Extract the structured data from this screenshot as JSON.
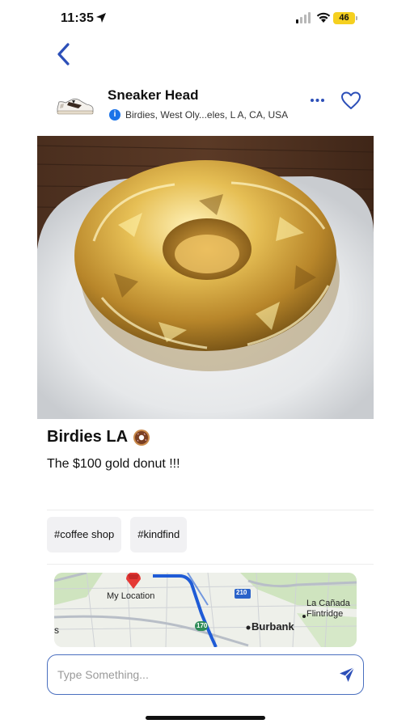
{
  "status_bar": {
    "time": "11:35",
    "battery": "46"
  },
  "post": {
    "user_name": "Sneaker Head",
    "location": "Birdies, West Oly...eles, L A, CA, USA",
    "title": "Birdies LA",
    "title_emoji": "🍩",
    "caption": "The $100 gold donut !!!",
    "tags": [
      "#coffee shop",
      "#kindfind"
    ]
  },
  "map": {
    "labels": {
      "my_location": "My Location",
      "la_canada": "La Cañada",
      "flintridge": "Flintridge",
      "burbank": "Burbank",
      "hwy_210": "210",
      "hwy_170": "170",
      "edge_fragment": "s"
    }
  },
  "input": {
    "placeholder": "Type Something..."
  },
  "icons": {
    "back": "chevron-left-icon",
    "more": "more-dots-icon",
    "favorite": "heart-outline-icon",
    "send": "send-icon",
    "info": "info-icon"
  },
  "colors": {
    "accent": "#2c4fb8",
    "battery": "#f5d020",
    "gold": "#d4a62a"
  }
}
